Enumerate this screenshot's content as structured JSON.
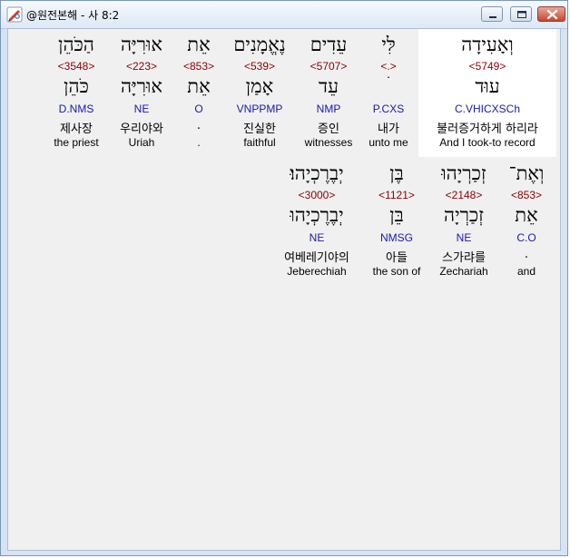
{
  "window": {
    "title": "@원전본해 - 사 8:2"
  },
  "colors": {
    "strong": "#8b0000",
    "parse": "#1a1aa6",
    "highlight_bg": "#ffffff"
  },
  "rows": [
    {
      "words": [
        {
          "heb": "וְאָעִידָה",
          "strong": "<5749>",
          "lemma": "עוּד",
          "parse": "C.VHICXSCh",
          "kor": "불러증거하게 하리라",
          "eng": "And I took-to record"
        },
        {
          "heb": "לִּי",
          "strong": "<.>",
          "lemma": "ׄ",
          "parse": "P.CXS",
          "kor": "내가",
          "eng": "unto me"
        },
        {
          "heb": "עֵדִים",
          "strong": "<5707>",
          "lemma": "עֵד",
          "parse": "NMP",
          "kor": "증인",
          "eng": "witnesses"
        },
        {
          "heb": "נֶאֱמָנִים",
          "strong": "<539>",
          "lemma": "אָמַן",
          "parse": "VNPPMP",
          "kor": "진실한",
          "eng": "faithful"
        },
        {
          "heb": "אֵת",
          "strong": "<853>",
          "lemma": "אֵת",
          "parse": "O",
          "kor": ".",
          "eng": "."
        },
        {
          "heb": "אוּרִיָּה",
          "strong": "<223>",
          "lemma": "אוּרִיָּה",
          "parse": "NE",
          "kor": "우리야와",
          "eng": "Uriah"
        },
        {
          "heb": "הַכֹּהֵן",
          "strong": "<3548>",
          "lemma": "כֹּהֵן",
          "parse": "D.NMS",
          "kor": "제사장",
          "eng": "the priest"
        }
      ]
    },
    {
      "words": [
        {
          "heb": "וְאֶת־",
          "strong": "<853>",
          "lemma": "אֵת",
          "parse": "C.O",
          "kor": ".",
          "eng": "and"
        },
        {
          "heb": "זְכַרְיָהוּ",
          "strong": "<2148>",
          "lemma": "זְכַרְיָה",
          "parse": "NE",
          "kor": "스가랴를",
          "eng": "Zechariah"
        },
        {
          "heb": "בֶּן",
          "strong": "<1121>",
          "lemma": "בֵּן",
          "parse": "NMSG",
          "kor": "아들",
          "eng": "the son of"
        },
        {
          "heb": "יְבֶרֶכְיָהוּ׃",
          "strong": "<3000>",
          "lemma": "יְבֶרֶכְיָהוּ",
          "parse": "NE",
          "kor": "여베레기야의",
          "eng": "Jeberechiah"
        }
      ]
    }
  ]
}
